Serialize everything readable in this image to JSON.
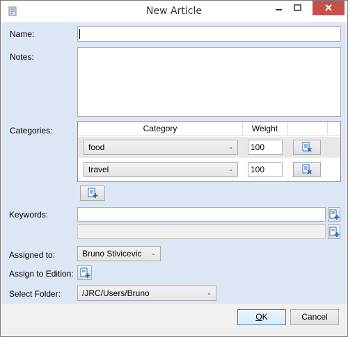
{
  "window": {
    "title": "New Article"
  },
  "form": {
    "name_label": "Name:",
    "name_value": "",
    "notes_label": "Notes:",
    "notes_value": "",
    "categories_label": "Categories:",
    "categories_grid": {
      "columns": [
        "Category",
        "Weight"
      ],
      "rows": [
        {
          "category": "food",
          "weight": "100",
          "selected": true
        },
        {
          "category": "travel",
          "weight": "100",
          "selected": false
        }
      ]
    },
    "keywords_label": "Keywords:",
    "keywords": [
      "",
      ""
    ],
    "assigned_to_label": "Assigned to:",
    "assigned_to_value": "Bruno Stivicevic",
    "assign_to_edition_label": "Assign to Edition:",
    "select_folder_label": "Select Folder:",
    "select_folder_value": "/JRC/Users/Bruno"
  },
  "buttons": {
    "ok_label": "OK",
    "ok_prefix": "",
    "ok_mnemonic": "O",
    "ok_rest": "K",
    "cancel_label": "Cancel"
  },
  "colors": {
    "content_bg": "#dce6f4",
    "close_button": "#c7504c",
    "default_border": "#3c7fb1"
  },
  "icons": [
    "app-icon",
    "minimize-icon",
    "maximize-icon",
    "close-icon",
    "delete-row-icon",
    "add-row-icon"
  ]
}
